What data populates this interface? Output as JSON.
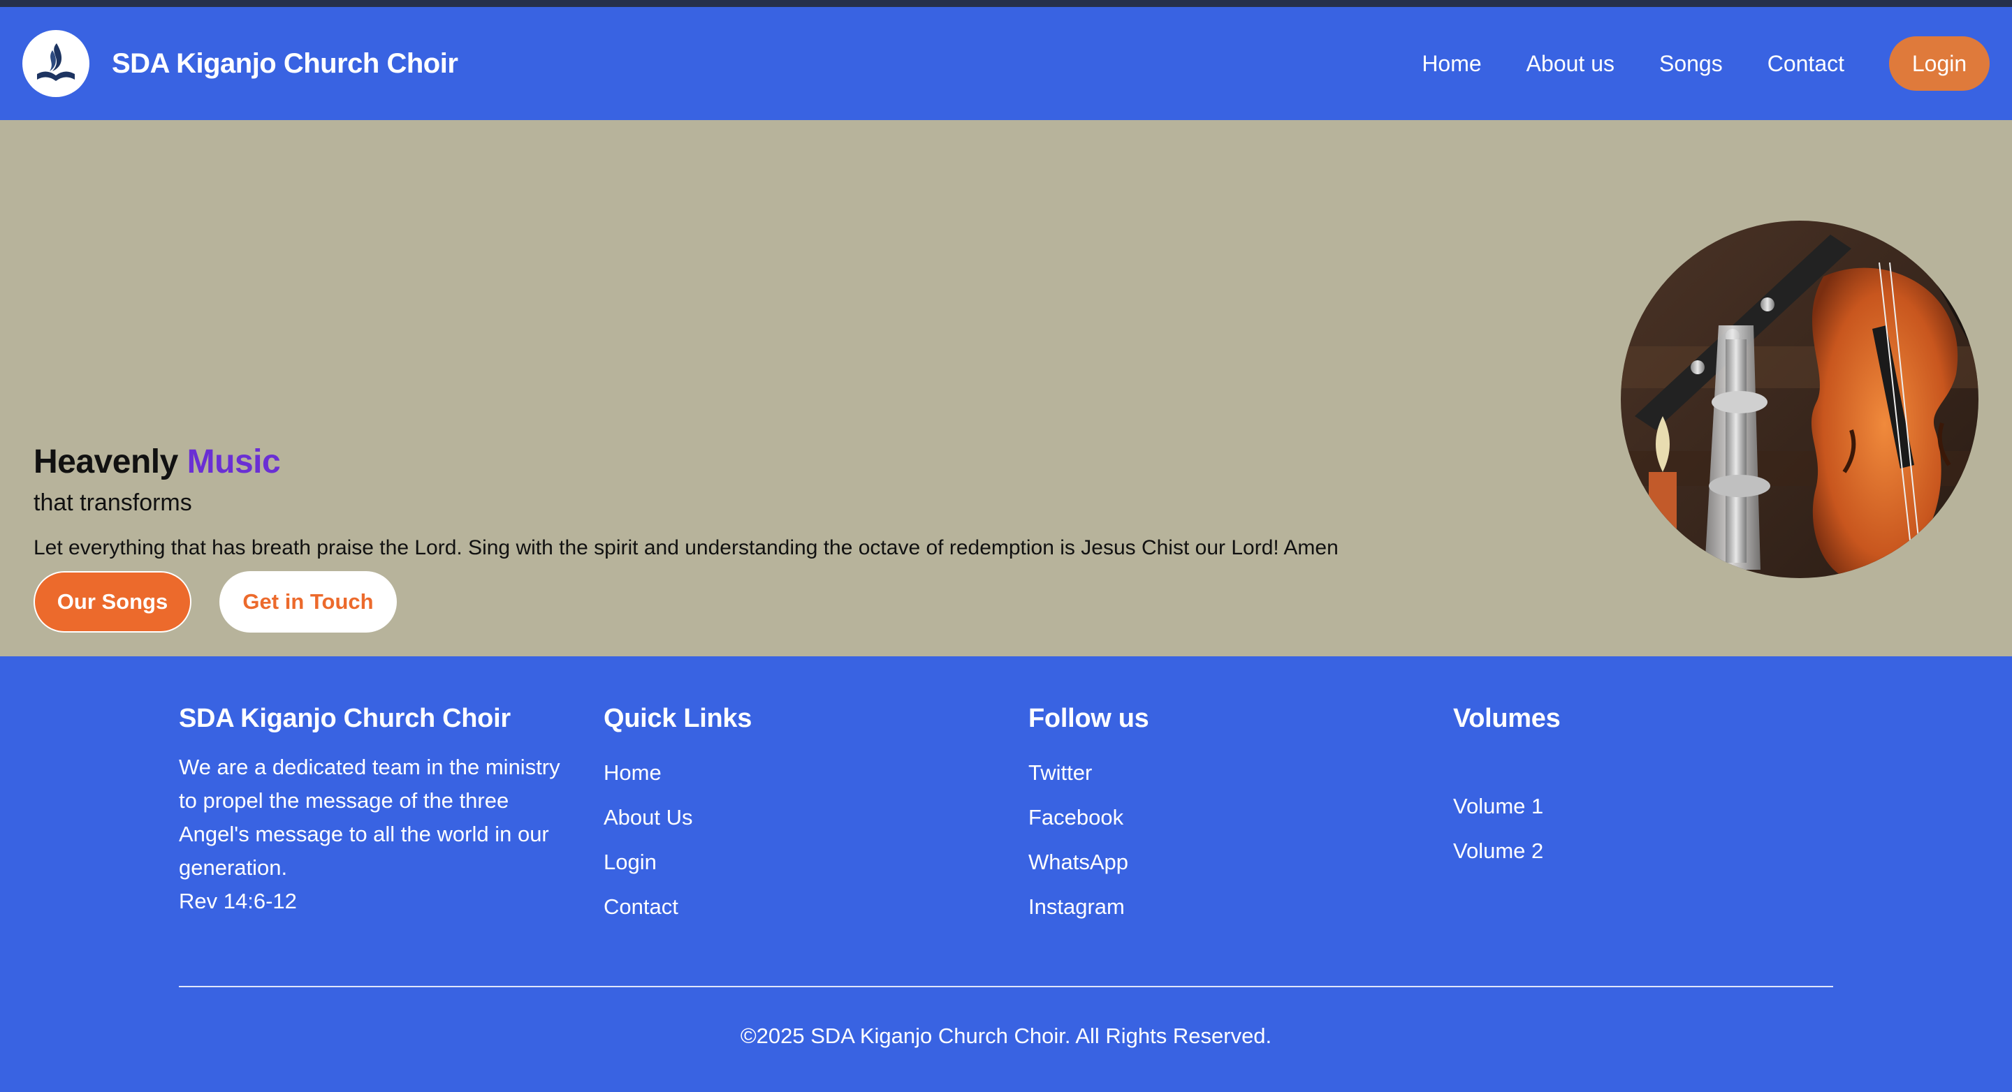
{
  "header": {
    "brand": "SDA Kiganjo Church Choir",
    "logo_icon": "sda-flame-bible-logo",
    "nav": [
      "Home",
      "About us",
      "Songs",
      "Contact"
    ],
    "login": "Login"
  },
  "hero": {
    "title_part1": "Heavenly",
    "title_part2": "Music",
    "subtitle": "that transforms",
    "lead": "Let everything that has breath praise the Lord. Sing with the spirit and understanding the octave of redemption is Jesus Chist our Lord! Amen",
    "btn_primary": "Our Songs",
    "btn_secondary": "Get in Touch",
    "image_icon": "musical-instruments-photo"
  },
  "footer": {
    "about": {
      "title": "SDA Kiganjo Church Choir",
      "text": "We are a dedicated team in the ministry to propel the message of the three Angel's message to all the world in our generation.",
      "verse": "Rev 14:6-12"
    },
    "quick_links": {
      "title": "Quick Links",
      "items": [
        "Home",
        "About Us",
        "Login",
        "Contact"
      ]
    },
    "follow": {
      "title": "Follow us",
      "items": [
        "Twitter",
        "Facebook",
        "WhatsApp",
        "Instagram"
      ]
    },
    "volumes": {
      "title": "Volumes",
      "items": [
        "Volume 1",
        "Volume 2"
      ]
    },
    "copyright": "©2025 SDA Kiganjo Church Choir. All Rights Reserved."
  },
  "colors": {
    "primary": "#3963e2",
    "accent_orange": "#ec6a2c",
    "login_orange": "#df7a3b",
    "hero_bg": "#b7b39b",
    "purple": "#6a2fd4"
  }
}
